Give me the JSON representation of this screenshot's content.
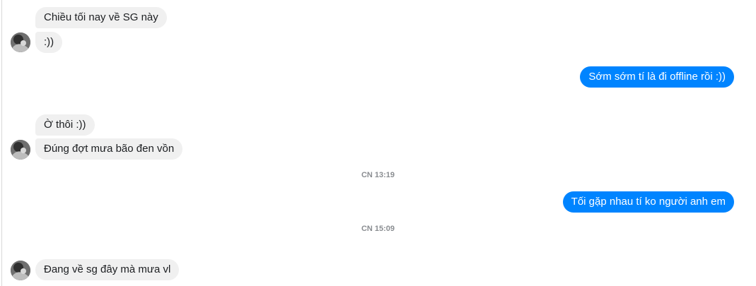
{
  "conversation": {
    "messages": [
      {
        "side": "in",
        "text": "Chiều tối nay về SG này"
      },
      {
        "side": "in",
        "text": ":))"
      },
      {
        "side": "out",
        "text": "Sớm sớm tí là đi offline rồi :))"
      },
      {
        "side": "in",
        "text": "Ờ thôi :))"
      },
      {
        "side": "in",
        "text": "Đúng đợt mưa bão đen vồn"
      },
      {
        "side": "out",
        "text": "Tối gặp nhau tí ko người anh em"
      },
      {
        "side": "in",
        "text": "Đang về sg đây mà mưa vl"
      }
    ],
    "timestamps": [
      "CN 13:19",
      "CN 15:09"
    ]
  },
  "colors": {
    "incoming_bubble": "#f0f0f0",
    "outgoing_bubble": "#0084ff",
    "timestamp_text": "#8a8d91"
  }
}
